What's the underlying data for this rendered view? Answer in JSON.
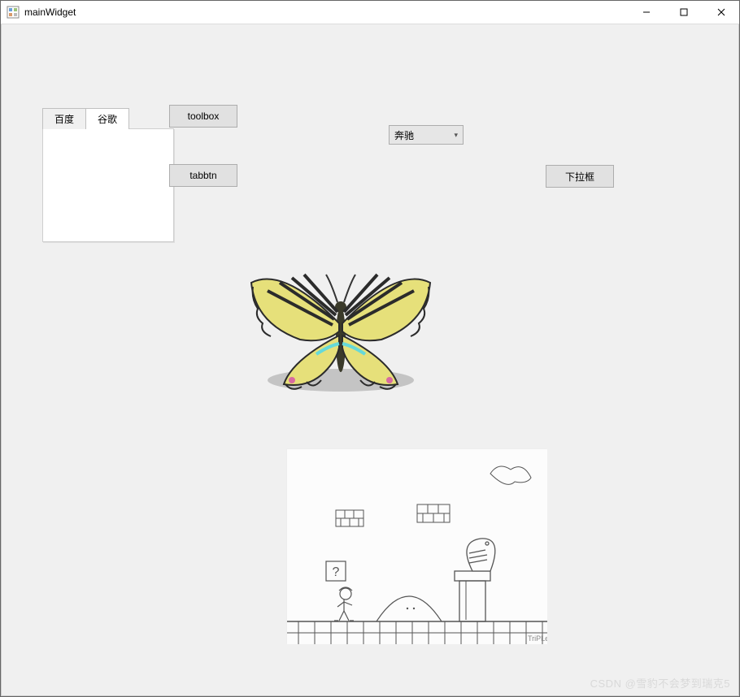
{
  "window": {
    "title": "mainWidget",
    "minimize_label": "Minimize",
    "maximize_label": "Maximize",
    "close_label": "Close"
  },
  "tabs": {
    "items": [
      {
        "label": "百度",
        "active": false
      },
      {
        "label": "谷歌",
        "active": true
      }
    ]
  },
  "buttons": {
    "toolbox": "toolbox",
    "tabbtn": "tabbtn",
    "dropdown_btn": "下拉框"
  },
  "combo": {
    "selected": "奔驰"
  },
  "images": {
    "butterfly_alt": "butterfly",
    "mario_alt": "mario-sketch"
  },
  "watermark": "CSDN @雪豹不会梦到瑞克5"
}
